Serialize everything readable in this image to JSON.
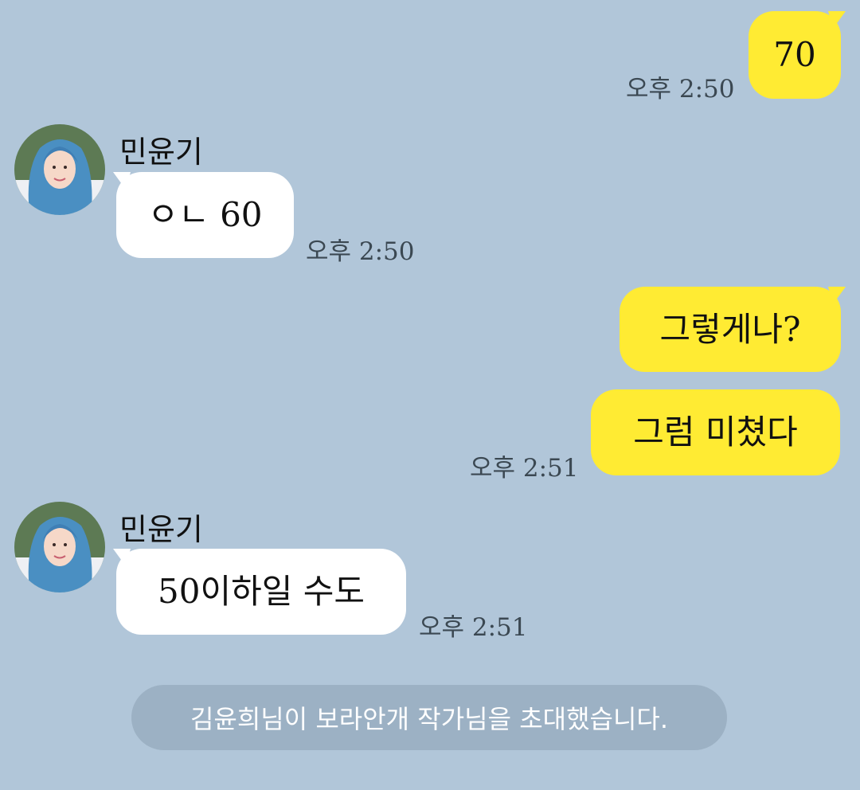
{
  "chat": {
    "contact_name": "민윤기",
    "messages": [
      {
        "text": "70",
        "time": "오후 2:50"
      },
      {
        "text": "ㅇㄴ 60",
        "time": "오후 2:50"
      },
      {
        "text": "그렇게나?"
      },
      {
        "text": "그럼 미쳤다",
        "time": "오후 2:51"
      },
      {
        "text": "50이하일 수도",
        "time": "오후 2:51"
      }
    ],
    "system_notice": "김윤희님이 보라안개 작가님을 초대했습니다."
  },
  "colors": {
    "background": "#b1c6d9",
    "my_bubble": "#ffeb33",
    "their_bubble": "#ffffff"
  }
}
